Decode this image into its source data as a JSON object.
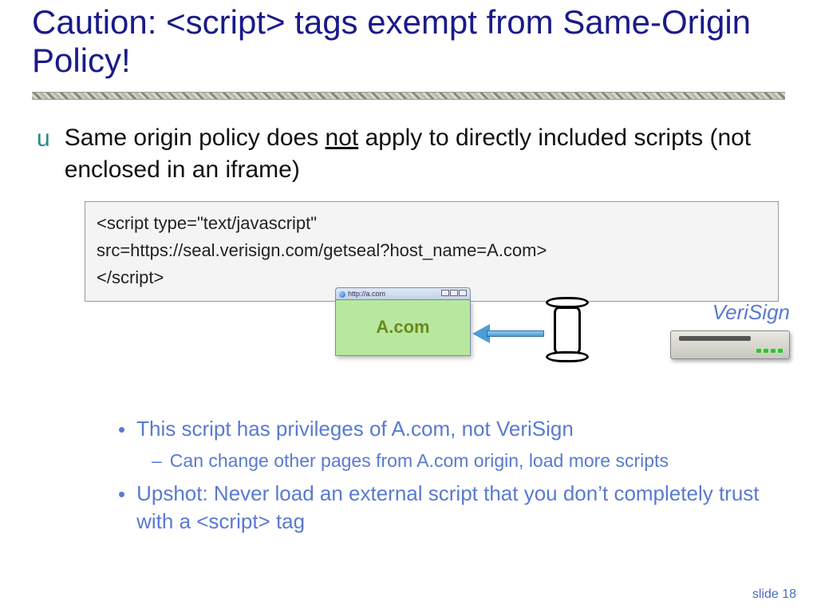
{
  "title": "Caution: <script> tags exempt from Same-Origin Policy!",
  "bullet1": {
    "pre": "Same origin policy does ",
    "underlined": "not",
    "post": " apply to directly included scripts (not enclosed in an iframe)"
  },
  "code": {
    "line1": "<script type=\"text/javascript\"",
    "line2": "src=https://seal.verisign.com/getseal?host_name=A.com>",
    "line3": "</script>"
  },
  "diagram": {
    "browser_url": "http://a.com",
    "browser_domain": "A.com",
    "server_label": "VeriSign"
  },
  "sub": {
    "b1": "This script has privileges of A.com, not VeriSign",
    "b1_sub": "Can change other pages from A.com origin, load more scripts",
    "b2": "Upshot: Never load an external script that you don’t completely trust with a <script> tag"
  },
  "footer": "slide 18"
}
